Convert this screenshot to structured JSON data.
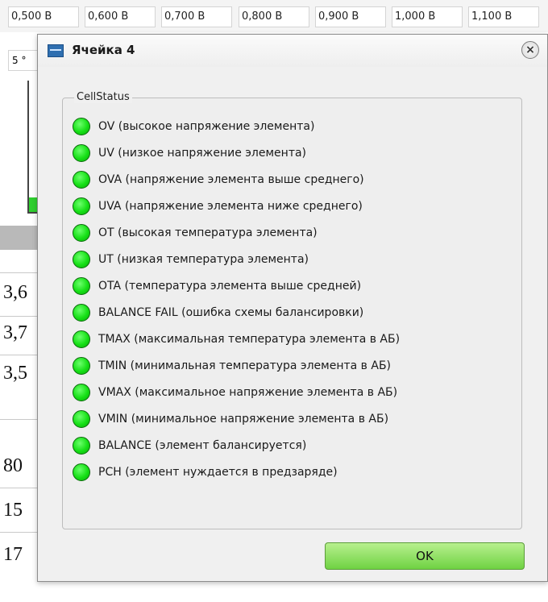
{
  "background": {
    "voltage_headers": [
      "0,500 В",
      "0,600 В",
      "0,700 В",
      "0,800 В",
      "0,900 В",
      "1,000 В",
      "1,100 В"
    ],
    "temp_cell": "5 °",
    "left_values": [
      "3,6",
      "3,7",
      "3,5",
      "80",
      "15",
      "17"
    ],
    "bar_color": "#2fcf2f"
  },
  "dialog": {
    "title": "Ячейка 4",
    "icon": "window-app-icon",
    "close_label": "×",
    "group_title": "CellStatus",
    "led_color": "#16e016",
    "status_items": [
      "OV (высокое напряжение элемента)",
      "UV (низкое напряжение элемента)",
      "OVA (напряжение элемента выше среднего)",
      "UVA (напряжение элемента ниже среднего)",
      "OT (высокая температура элемента)",
      "UT (низкая температура элемента)",
      "OTA (температура элемента выше средней)",
      "BALANCE FAIL (ошибка схемы балансировки)",
      "TMAX (максимальная температура элемента в АБ)",
      "TMIN (минимальная температура элемента в АБ)",
      "VMAX (максимальное напряжение элемента в АБ)",
      "VMIN (минимальное напряжение элемента в АБ)",
      "BALANCE (элемент балансируется)",
      "PCH (элемент нуждается в предзаряде)"
    ],
    "ok_label": "OK",
    "ok_color": "#6fd243"
  }
}
